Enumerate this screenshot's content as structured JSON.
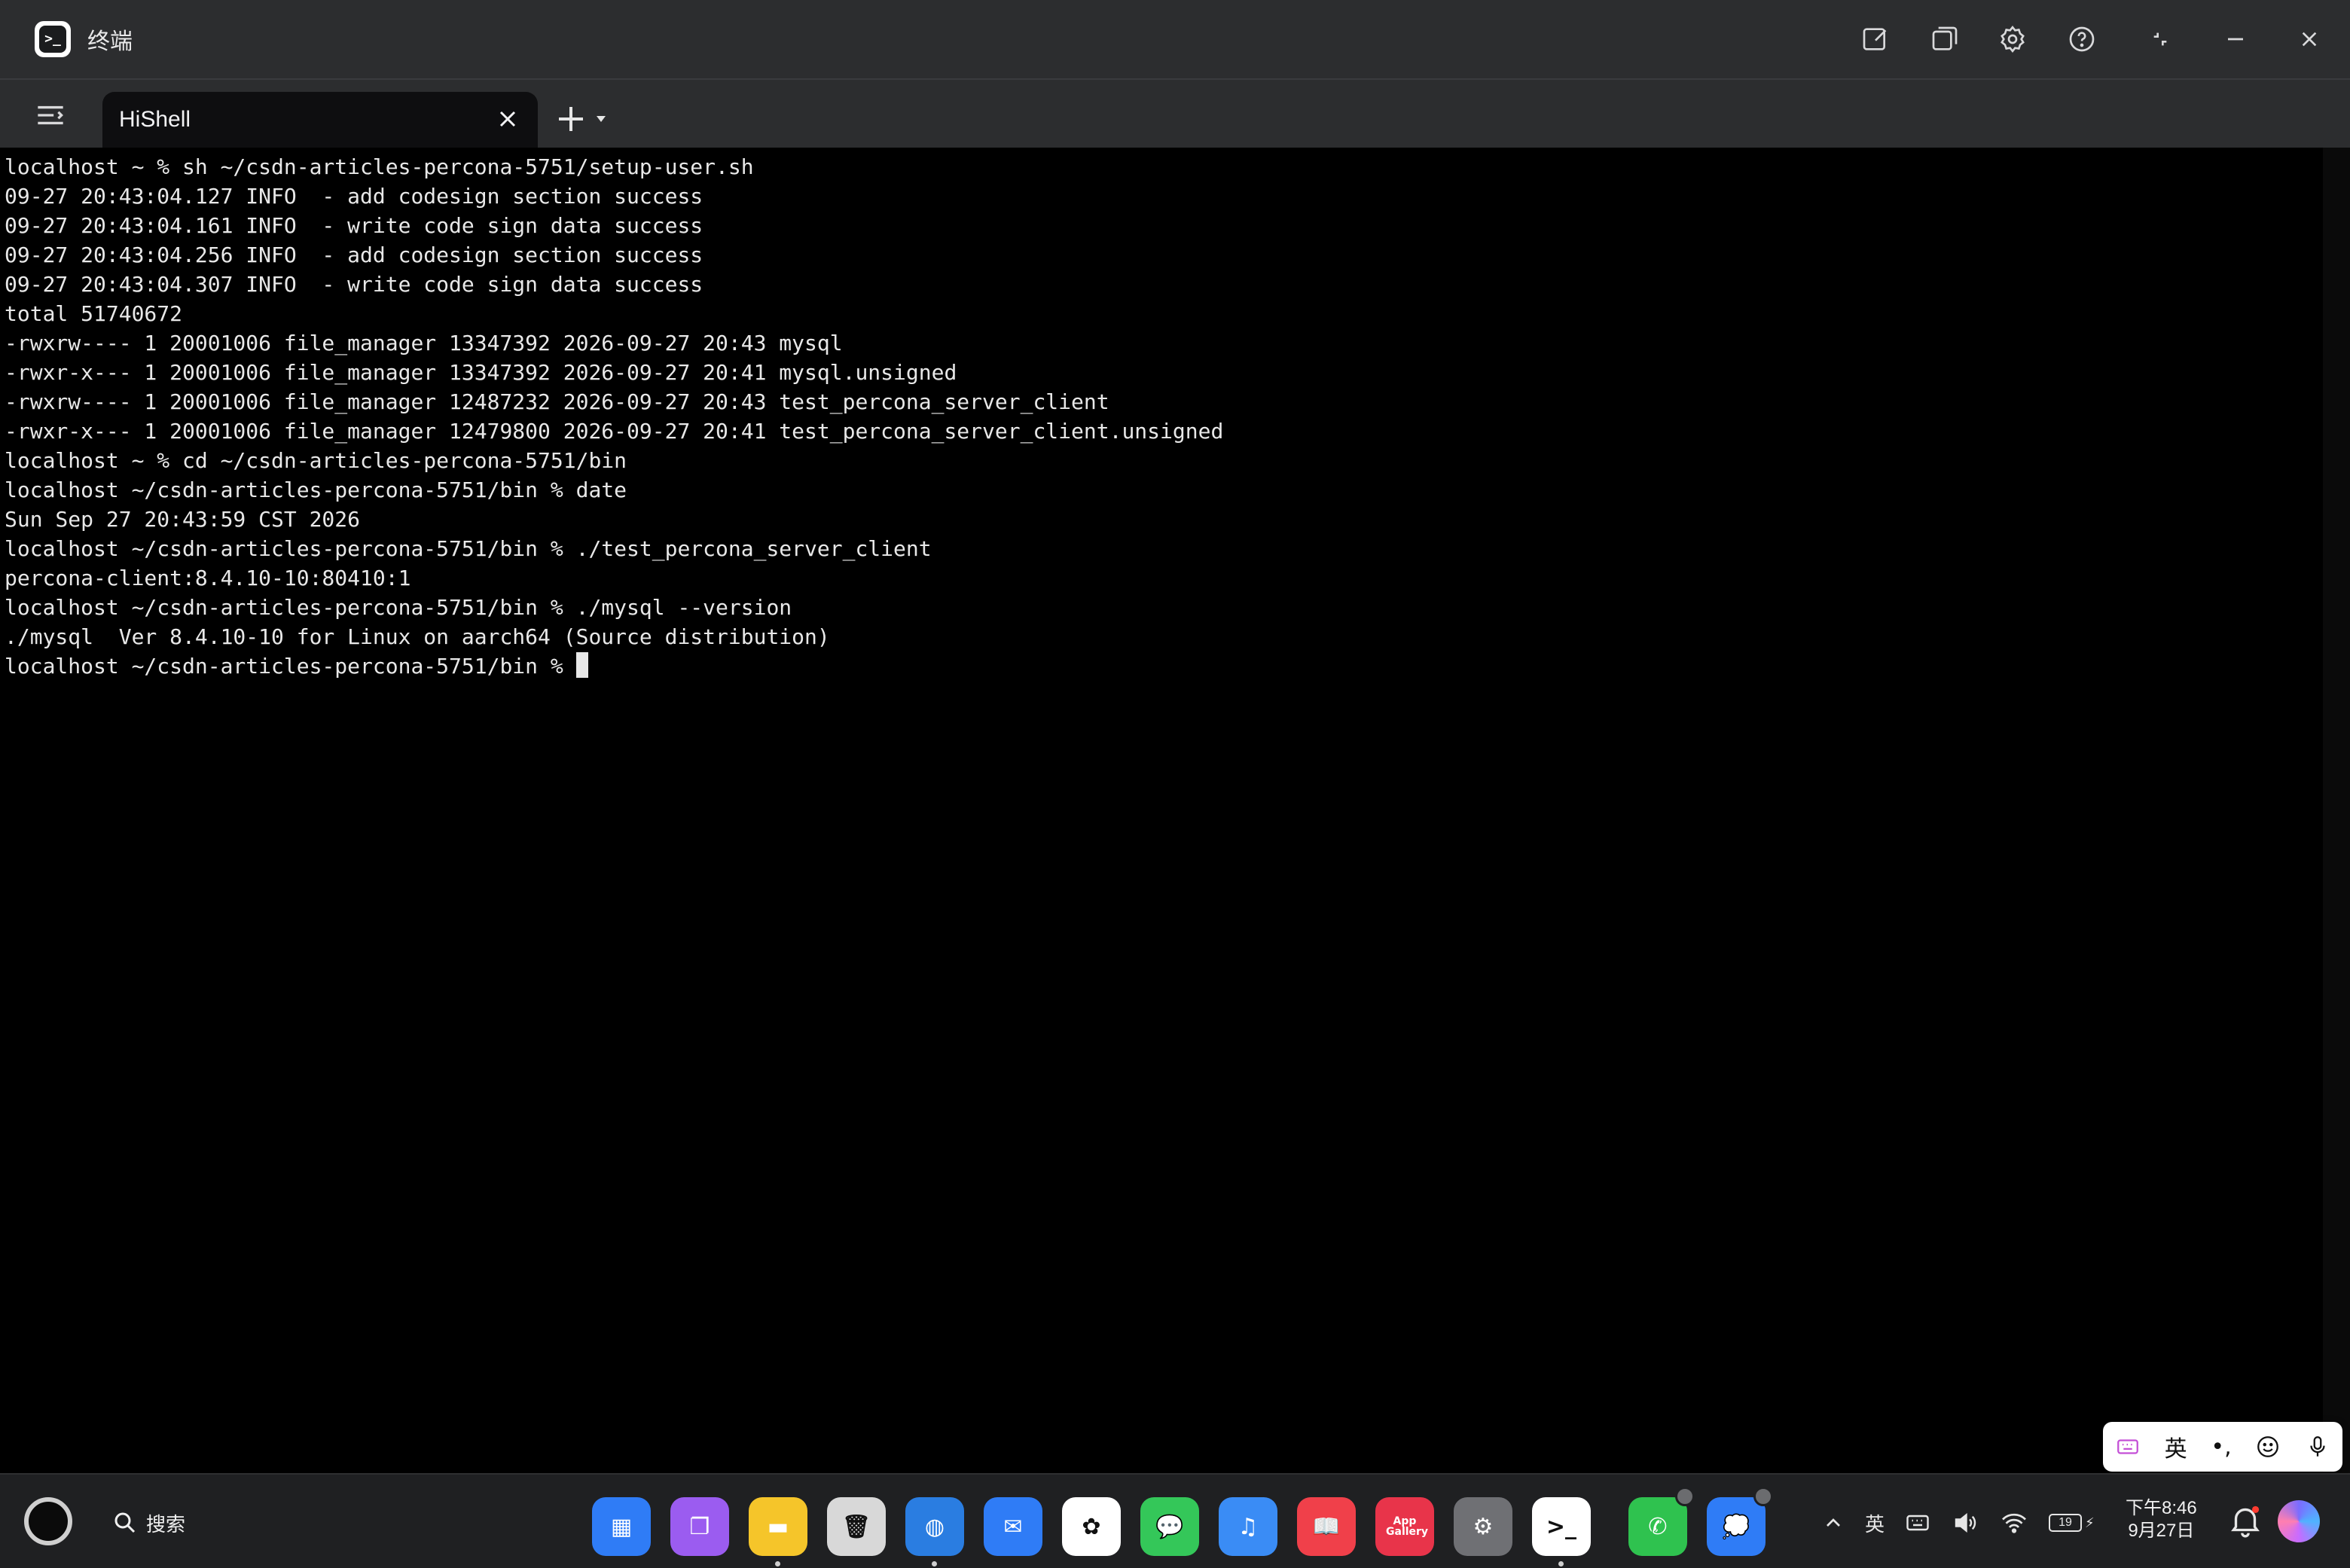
{
  "window": {
    "icon_glyph": ">_",
    "title": "终端"
  },
  "tab": {
    "label": "HiShell",
    "new_tab_symbol": "+"
  },
  "terminal": {
    "lines": [
      "localhost ~ % sh ~/csdn-articles-percona-5751/setup-user.sh",
      "09-27 20:43:04.127 INFO  - add codesign section success",
      "09-27 20:43:04.161 INFO  - write code sign data success",
      "09-27 20:43:04.256 INFO  - add codesign section success",
      "09-27 20:43:04.307 INFO  - write code sign data success",
      "total 51740672",
      "-rwxrw---- 1 20001006 file_manager 13347392 2026-09-27 20:43 mysql",
      "-rwxr-x--- 1 20001006 file_manager 13347392 2026-09-27 20:41 mysql.unsigned",
      "-rwxrw---- 1 20001006 file_manager 12487232 2026-09-27 20:43 test_percona_server_client",
      "-rwxr-x--- 1 20001006 file_manager 12479800 2026-09-27 20:41 test_percona_server_client.unsigned",
      "localhost ~ % cd ~/csdn-articles-percona-5751/bin",
      "localhost ~/csdn-articles-percona-5751/bin % date",
      "Sun Sep 27 20:43:59 CST 2026",
      "localhost ~/csdn-articles-percona-5751/bin % ./test_percona_server_client",
      "percona-client:8.4.10-10:80410:1",
      "localhost ~/csdn-articles-percona-5751/bin % ./mysql --version",
      "./mysql  Ver 8.4.10-10 for Linux on aarch64 (Source distribution)"
    ],
    "prompt": "localhost ~/csdn-articles-percona-5751/bin % "
  },
  "ime": {
    "lang": "英",
    "punct": "•,"
  },
  "taskbar": {
    "search_label": "搜索",
    "apps": [
      {
        "name": "app-launcher",
        "color": "#2f7cf6",
        "glyph": "▦",
        "running": false,
        "badge": false
      },
      {
        "name": "multi-window",
        "color": "#9b5cf0",
        "glyph": "❐",
        "running": false,
        "badge": false
      },
      {
        "name": "files",
        "color": "#f5c52a",
        "glyph": "▬",
        "running": true,
        "badge": false
      },
      {
        "name": "trash",
        "color": "#d8d8d8",
        "glyph": "🗑",
        "running": false,
        "badge": false
      },
      {
        "name": "browser",
        "color": "#2a7de1",
        "glyph": "◍",
        "running": true,
        "badge": false
      },
      {
        "name": "mail",
        "color": "#2f7cf6",
        "glyph": "✉",
        "running": false,
        "badge": false
      },
      {
        "name": "gallery",
        "color": "#ffffff",
        "glyph": "✿",
        "running": false,
        "badge": false
      },
      {
        "name": "messages",
        "color": "#34c759",
        "glyph": "💬",
        "running": false,
        "badge": false
      },
      {
        "name": "music",
        "color": "#3a8cf5",
        "glyph": "♫",
        "running": false,
        "badge": false
      },
      {
        "name": "books",
        "color": "#f0404a",
        "glyph": "📖",
        "running": false,
        "badge": false
      },
      {
        "name": "appgallery",
        "color": "#e8344a",
        "glyph": "App Gallery",
        "running": false,
        "badge": false
      },
      {
        "name": "settings",
        "color": "#6f7074",
        "glyph": "⚙",
        "running": false,
        "badge": false
      },
      {
        "name": "terminal",
        "color": "#ffffff",
        "glyph": ">_",
        "running": true,
        "badge": false
      },
      {
        "name": "phone",
        "color": "#2fc24f",
        "glyph": "✆",
        "running": false,
        "badge": true
      },
      {
        "name": "chat",
        "color": "#2f7cf6",
        "glyph": "💭",
        "running": false,
        "badge": true
      }
    ],
    "tray": {
      "ime_indicator": "英",
      "battery": "19"
    },
    "clock": {
      "time": "下午8:46",
      "date": "9月27日"
    }
  },
  "colors": {
    "titlebar_bg": "#2c2d2f",
    "terminal_bg": "#000000",
    "terminal_fg": "#e8e8e8",
    "taskbar_bg": "#1f2022"
  }
}
